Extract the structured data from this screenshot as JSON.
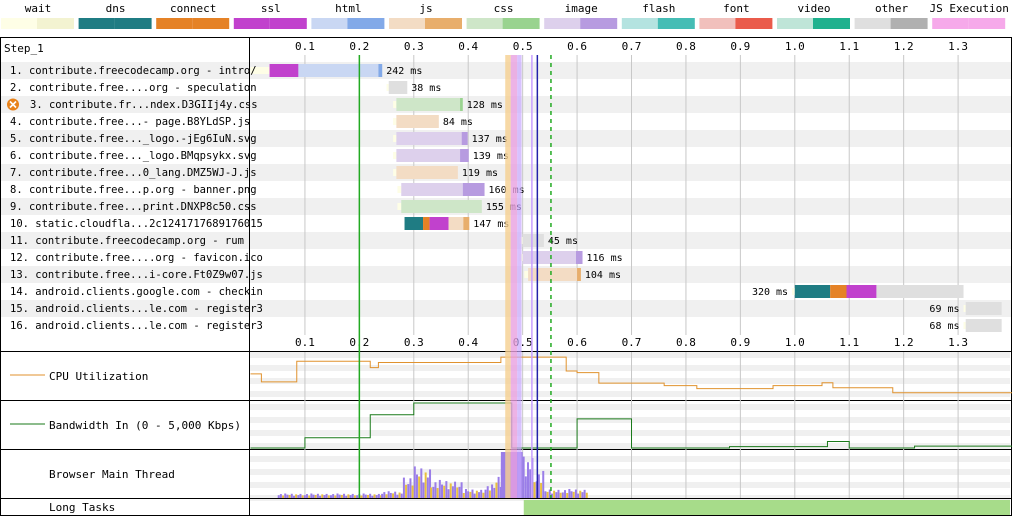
{
  "legend": [
    {
      "label": "wait",
      "c1": "#fefee6",
      "c2": "#f3f3d1"
    },
    {
      "label": "dns",
      "c1": "#1f7c83",
      "c2": "#1f7c83"
    },
    {
      "label": "connect",
      "c1": "#e58226",
      "c2": "#e58226"
    },
    {
      "label": "ssl",
      "c1": "#c141cd",
      "c2": "#c141cd"
    },
    {
      "label": "html",
      "c1": "#c9d7f3",
      "c2": "#82a9e8"
    },
    {
      "label": "js",
      "c1": "#f3dcc4",
      "c2": "#e8ae6c"
    },
    {
      "label": "css",
      "c1": "#cee6c8",
      "c2": "#99d38f"
    },
    {
      "label": "image",
      "c1": "#ddd0ec",
      "c2": "#b79be0"
    },
    {
      "label": "flash",
      "c1": "#b4e3e0",
      "c2": "#45bdb5"
    },
    {
      "label": "font",
      "c1": "#f1c0bc",
      "c2": "#ea5b4b"
    },
    {
      "label": "video",
      "c1": "#bfe5d8",
      "c2": "#1fb18e"
    },
    {
      "label": "other",
      "c1": "#dfdfdf",
      "c2": "#b0b0b0"
    },
    {
      "label": "JS Execution",
      "c1": "#f6a9ea",
      "c2": "#f6a9ea"
    }
  ],
  "step_label": "Step_1",
  "timeline": {
    "min": 0,
    "max": 1.4,
    "ticks": [
      "0.1",
      "0.2",
      "0.3",
      "0.4",
      "0.5",
      "0.6",
      "0.7",
      "0.8",
      "0.9",
      "1.0",
      "1.1",
      "1.2",
      "1.3"
    ]
  },
  "markers": [
    {
      "name": "start-render",
      "t": 0.2,
      "color": "#22aa22",
      "style": "solid"
    },
    {
      "name": "dom-interactive",
      "t": 0.472,
      "color": "#f0c040",
      "style": "solid"
    },
    {
      "name": "dom-content-loaded",
      "t": 0.485,
      "color": "#d880d8",
      "style": "solid"
    },
    {
      "name": "on-load",
      "t": 0.517,
      "color": "#c8a0ff",
      "style": "solid"
    },
    {
      "name": "on-load-end",
      "t": 0.527,
      "color": "#2222aa",
      "style": "solid"
    },
    {
      "name": "document-complete",
      "t": 0.552,
      "color": "#22aa22",
      "style": "dashed"
    }
  ],
  "requests": [
    {
      "label": "1. contribute.freecodecamp.org - intro/",
      "ms": "242 ms",
      "type": "html",
      "segs": [
        [
          "wait",
          0.0,
          0.035
        ],
        [
          "ssl",
          0.035,
          0.088
        ],
        [
          "html1",
          0.088,
          0.235
        ],
        [
          "html2",
          0.235,
          0.242
        ]
      ]
    },
    {
      "label": "2. contribute.free....org - speculation",
      "ms": "38 ms",
      "type": "other",
      "segs": [
        [
          "wait",
          0.25,
          0.254
        ],
        [
          "other1",
          0.254,
          0.288
        ]
      ]
    },
    {
      "label": "3. contribute.fr...ndex.D3GIIj4y.css",
      "ms": "128 ms",
      "type": "css",
      "warn": true,
      "segs": [
        [
          "wait",
          0.262,
          0.268
        ],
        [
          "css1",
          0.268,
          0.385
        ],
        [
          "css2",
          0.385,
          0.39
        ]
      ]
    },
    {
      "label": "4. contribute.free...- page.B8YLdSP.js",
      "ms": "84 ms",
      "type": "js",
      "segs": [
        [
          "wait",
          0.262,
          0.268
        ],
        [
          "js1",
          0.268,
          0.346
        ]
      ]
    },
    {
      "label": "5. contribute.free..._logo.-jEg6IuN.svg",
      "ms": "137 ms",
      "type": "image",
      "segs": [
        [
          "wait",
          0.262,
          0.268
        ],
        [
          "img1",
          0.268,
          0.388
        ],
        [
          "img2",
          0.388,
          0.399
        ]
      ]
    },
    {
      "label": "6. contribute.free..._logo.BMqpsykx.svg",
      "ms": "139 ms",
      "type": "image",
      "segs": [
        [
          "wait",
          0.262,
          0.268
        ],
        [
          "img1",
          0.268,
          0.385
        ],
        [
          "img2",
          0.385,
          0.401
        ]
      ]
    },
    {
      "label": "7. contribute.free...0_lang.DMZ5WJ-J.js",
      "ms": "119 ms",
      "type": "js",
      "segs": [
        [
          "wait",
          0.262,
          0.268
        ],
        [
          "js1",
          0.268,
          0.381
        ]
      ]
    },
    {
      "label": "8. contribute.free...p.org - banner.png",
      "ms": "160 ms",
      "type": "image",
      "segs": [
        [
          "wait",
          0.27,
          0.277
        ],
        [
          "img1",
          0.277,
          0.39
        ],
        [
          "img2",
          0.39,
          0.43
        ]
      ]
    },
    {
      "label": "9. contribute.free...print.DNXP8c50.css",
      "ms": "155 ms",
      "type": "css",
      "segs": [
        [
          "wait",
          0.27,
          0.277
        ],
        [
          "css1",
          0.277,
          0.425
        ]
      ]
    },
    {
      "label": "10. static.cloudfla...2c1241717689176015",
      "ms": "147 ms",
      "type": "js",
      "segs": [
        [
          "dns",
          0.283,
          0.317
        ],
        [
          "connect",
          0.317,
          0.329
        ],
        [
          "ssl",
          0.329,
          0.364
        ],
        [
          "js1",
          0.364,
          0.391
        ],
        [
          "js2",
          0.391,
          0.402
        ]
      ]
    },
    {
      "label": "11. contribute.freecodecamp.org - rum",
      "ms": "45 ms",
      "type": "other",
      "segs": [
        [
          "wait",
          0.494,
          0.5
        ],
        [
          "other1",
          0.5,
          0.539
        ]
      ]
    },
    {
      "label": "12. contribute.free....org - favicon.ico",
      "ms": "116 ms",
      "type": "image",
      "segs": [
        [
          "wait",
          0.494,
          0.5
        ],
        [
          "img1",
          0.5,
          0.598
        ],
        [
          "img2",
          0.598,
          0.61
        ]
      ]
    },
    {
      "label": "13. contribute.free...i-core.Ft0Z9w07.js",
      "ms": "104 ms",
      "type": "js",
      "segs": [
        [
          "wait",
          0.503,
          0.51
        ],
        [
          "js1",
          0.51,
          0.6
        ],
        [
          "js2",
          0.6,
          0.607
        ]
      ]
    },
    {
      "label": "14. android.clients.google.com - checkin",
      "ms": "320 ms",
      "type": "other",
      "segs": [
        [
          "wait",
          0.995,
          1.0
        ],
        [
          "dns",
          1.0,
          1.065
        ],
        [
          "connect",
          1.065,
          1.095
        ],
        [
          "ssl",
          1.095,
          1.15
        ],
        [
          "other1",
          1.15,
          1.31
        ]
      ]
    },
    {
      "label": "15. android.clients...le.com - register3",
      "ms": "69 ms",
      "type": "other",
      "segs": [
        [
          "wait",
          1.31,
          1.314
        ],
        [
          "other1",
          1.314,
          1.38
        ]
      ]
    },
    {
      "label": "16. android.clients...le.com - register3",
      "ms": "68 ms",
      "type": "other",
      "segs": [
        [
          "wait",
          1.31,
          1.314
        ],
        [
          "other1",
          1.314,
          1.38
        ]
      ]
    }
  ],
  "panels": {
    "cpu_label": "CPU Utilization",
    "bw_label": "Bandwidth In (0 - 5,000 Kbps)",
    "main_label": "Browser Main Thread",
    "long_label": "Long Tasks"
  },
  "chart_data": {
    "type": "waterfall",
    "x_unit": "seconds",
    "xlim": [
      0,
      1.4
    ],
    "requests": [
      {
        "n": 1,
        "url": "contribute.freecodecamp.org - intro/",
        "duration_ms": 242,
        "type": "html"
      },
      {
        "n": 2,
        "url": "contribute.free....org - speculation",
        "duration_ms": 38,
        "type": "other"
      },
      {
        "n": 3,
        "url": "contribute.fr...ndex.D3GIIj4y.css",
        "duration_ms": 128,
        "type": "css"
      },
      {
        "n": 4,
        "url": "contribute.free...- page.B8YLdSP.js",
        "duration_ms": 84,
        "type": "js"
      },
      {
        "n": 5,
        "url": "contribute.free..._logo.-jEg6IuN.svg",
        "duration_ms": 137,
        "type": "image"
      },
      {
        "n": 6,
        "url": "contribute.free..._logo.BMqpsykx.svg",
        "duration_ms": 139,
        "type": "image"
      },
      {
        "n": 7,
        "url": "contribute.free...0_lang.DMZ5WJ-J.js",
        "duration_ms": 119,
        "type": "js"
      },
      {
        "n": 8,
        "url": "contribute.free...p.org - banner.png",
        "duration_ms": 160,
        "type": "image"
      },
      {
        "n": 9,
        "url": "contribute.free...print.DNXP8c50.css",
        "duration_ms": 155,
        "type": "css"
      },
      {
        "n": 10,
        "url": "static.cloudfla...2c1241717689176015",
        "duration_ms": 147,
        "type": "js"
      },
      {
        "n": 11,
        "url": "contribute.freecodecamp.org - rum",
        "duration_ms": 45,
        "type": "other"
      },
      {
        "n": 12,
        "url": "contribute.free....org - favicon.ico",
        "duration_ms": 116,
        "type": "image"
      },
      {
        "n": 13,
        "url": "contribute.free...i-core.Ft0Z9w07.js",
        "duration_ms": 104,
        "type": "js"
      },
      {
        "n": 14,
        "url": "android.clients.google.com - checkin",
        "duration_ms": 320,
        "type": "other"
      },
      {
        "n": 15,
        "url": "android.clients...le.com - register3",
        "duration_ms": 69,
        "type": "other"
      },
      {
        "n": 16,
        "url": "android.clients...le.com - register3",
        "duration_ms": 68,
        "type": "other"
      }
    ],
    "cpu": [
      [
        0,
        0.55
      ],
      [
        0.02,
        0.36
      ],
      [
        0.085,
        0.85
      ],
      [
        0.12,
        0.85
      ],
      [
        0.22,
        0.7
      ],
      [
        0.235,
        0.82
      ],
      [
        0.46,
        0.95
      ],
      [
        0.52,
        0.95
      ],
      [
        0.58,
        0.62
      ],
      [
        0.6,
        0.58
      ],
      [
        0.64,
        0.33
      ],
      [
        0.7,
        0.33
      ],
      [
        0.76,
        0.27
      ],
      [
        0.82,
        0.2
      ],
      [
        0.88,
        0.2
      ],
      [
        0.96,
        0.27
      ],
      [
        1.05,
        0.34
      ],
      [
        1.07,
        0.22
      ],
      [
        1.13,
        0.22
      ],
      [
        1.18,
        0.1
      ],
      [
        1.4,
        0.1
      ]
    ],
    "bandwidth": [
      [
        0,
        0.02
      ],
      [
        0.1,
        0.02
      ],
      [
        0.1,
        0.24
      ],
      [
        0.22,
        0.24
      ],
      [
        0.22,
        0.73
      ],
      [
        0.3,
        0.73
      ],
      [
        0.3,
        0.98
      ],
      [
        0.48,
        0.98
      ],
      [
        0.48,
        0.02
      ],
      [
        0.55,
        0.02
      ],
      [
        0.6,
        0.02
      ],
      [
        0.6,
        0.64
      ],
      [
        0.7,
        0.64
      ],
      [
        0.7,
        0.02
      ],
      [
        0.88,
        0.02
      ],
      [
        0.88,
        0.05
      ],
      [
        1.06,
        0.05
      ],
      [
        1.06,
        0.16
      ],
      [
        1.1,
        0.16
      ],
      [
        1.1,
        0.02
      ],
      [
        1.22,
        0.02
      ],
      [
        1.22,
        0.06
      ],
      [
        1.4,
        0.06
      ]
    ],
    "main_thread": [
      [
        0.05,
        0.1
      ],
      [
        0.24,
        0.15
      ],
      [
        0.28,
        0.5
      ],
      [
        0.3,
        0.7
      ],
      [
        0.33,
        0.4
      ],
      [
        0.39,
        0.2
      ],
      [
        0.43,
        0.3
      ],
      [
        0.45,
        0.5
      ],
      [
        0.46,
        0.98
      ],
      [
        0.48,
        0.98
      ],
      [
        0.5,
        0.98
      ],
      [
        0.52,
        0.6
      ],
      [
        0.54,
        0.2
      ],
      [
        0.62,
        0.05
      ]
    ],
    "long_tasks": [
      [
        0.48,
        1.4
      ]
    ]
  }
}
